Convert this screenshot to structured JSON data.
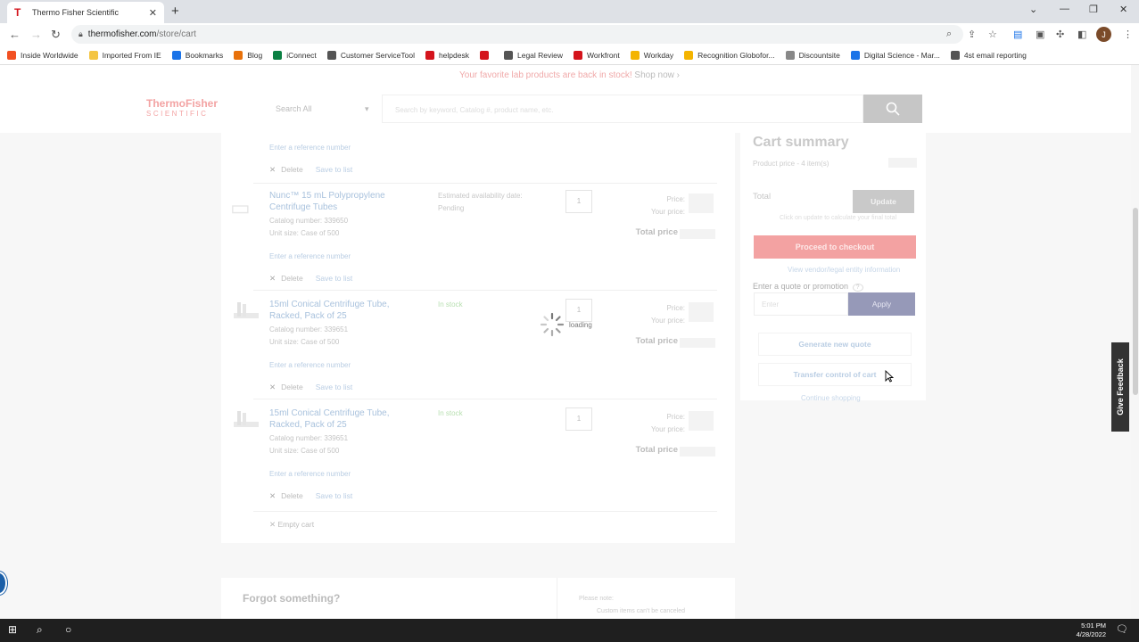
{
  "browser": {
    "tab_title": "Thermo Fisher Scientific",
    "tab_favicon": "T",
    "new_tab": "+",
    "url_host": "thermofisher.com",
    "url_path": "/store/cart",
    "profile_initial": "J",
    "bookmarks": [
      {
        "label": "Inside Worldwide",
        "icon": "windows-icon",
        "color": "#f25022"
      },
      {
        "label": "Imported From IE",
        "icon": "folder-icon",
        "color": "#f4c542"
      },
      {
        "label": "Bookmarks",
        "icon": "star-icon",
        "color": "#1a73e8"
      },
      {
        "label": "Blog",
        "icon": "blog-icon",
        "color": "#e8710a"
      },
      {
        "label": "iConnect",
        "icon": "iconnect-icon",
        "color": "#0b8043"
      },
      {
        "label": "Customer ServiceTool",
        "icon": "globe-icon",
        "color": "#555555"
      },
      {
        "label": "helpdesk",
        "icon": "thermo-icon",
        "color": "#d4141c"
      },
      {
        "label": "",
        "icon": "redarrow-icon",
        "color": "#d4141c"
      },
      {
        "label": "Legal Review",
        "icon": "globe-icon",
        "color": "#555555"
      },
      {
        "label": "Workfront",
        "icon": "pin-icon",
        "color": "#d4141c"
      },
      {
        "label": "Workday",
        "icon": "workday-icon",
        "color": "#f4b400"
      },
      {
        "label": "Recognition Globofor...",
        "icon": "star-icon",
        "color": "#f4b400"
      },
      {
        "label": "Discountsite",
        "icon": "dots-icon",
        "color": "#888888"
      },
      {
        "label": "Digital Science - Mar...",
        "icon": "ads-icon",
        "color": "#1a73e8"
      },
      {
        "label": "4st email reporting",
        "icon": "globe-icon",
        "color": "#555555"
      }
    ]
  },
  "page": {
    "promo_text": "Your favorite lab products are back in stock!",
    "promo_link": "Shop now ›",
    "logo_line1": "ThermoFisher",
    "logo_line2": "SCIENTIFIC",
    "search_category": "Search All",
    "search_placeholder": "Search by keyword, Catalog #, product name, etc.",
    "items": [
      {
        "name": "",
        "catalog": "",
        "unit": "",
        "availability": "",
        "qty": "",
        "refnum": "Enter a reference number",
        "delete": "Delete",
        "save": "Save to list"
      },
      {
        "name": "Nunc™ 15 mL Polypropylene Centrifuge Tubes",
        "catalog": "Catalog number: 339650",
        "unit": "Unit size: Case of 500",
        "availability": "Estimated availability date: Pending",
        "qty": "1",
        "price": "Price:",
        "your_price": "Your price:",
        "total": "Total price",
        "refnum": "Enter a reference number",
        "delete": "Delete",
        "save": "Save to list"
      },
      {
        "name": "15ml Conical Centrifuge Tube, Racked, Pack of 25",
        "catalog": "Catalog number: 339651",
        "unit": "Unit size: Case of 500",
        "availability": "In stock",
        "qty": "1",
        "price": "Price:",
        "your_price": "Your price:",
        "total": "Total price",
        "refnum": "Enter a reference number",
        "delete": "Delete",
        "save": "Save to list"
      },
      {
        "name": "15ml Conical Centrifuge Tube, Racked, Pack of 25",
        "catalog": "Catalog number: 339651",
        "unit": "Unit size: Case of 500",
        "availability": "In stock",
        "qty": "1",
        "price": "Price:",
        "your_price": "Your price:",
        "total": "Total price",
        "refnum": "Enter a reference number",
        "delete": "Delete",
        "save": "Save to list"
      }
    ],
    "loading_text": "loading",
    "empty_cart": "Empty cart",
    "summary": {
      "title": "Cart summary",
      "product_price": "Product price - 4 item(s)",
      "total": "Total",
      "update": "Update",
      "update_note": "Click on update to calculate your final total",
      "checkout": "Proceed to checkout",
      "vendor_link": "View vendor/legal entity information",
      "promo_label": "Enter a quote or promotion",
      "promo_help": "?",
      "promo_placeholder": "Enter",
      "apply": "Apply",
      "quote": "Generate new quote",
      "transfer": "Transfer control of cart",
      "continue": "Continue shopping"
    },
    "forgot_title": "Forgot something?",
    "forgot_note": "Please note:",
    "forgot_note2": "Custom items can't be canceled",
    "feedback": "Give Feedback"
  },
  "taskbar": {
    "time": "5:01 PM",
    "date": "4/28/2022"
  }
}
